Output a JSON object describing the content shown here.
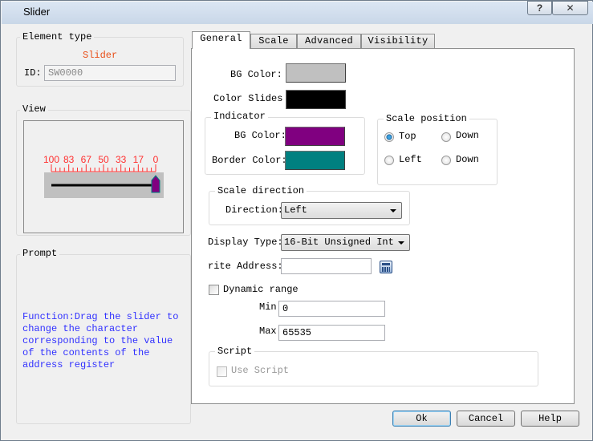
{
  "window": {
    "title": "Slider",
    "help_label": "?",
    "close_label": "✕"
  },
  "element_type": {
    "label": "Element type",
    "type": "Slider",
    "id_label": "ID:",
    "id_value": "SW0000"
  },
  "view": {
    "label": "View",
    "scale_labels": [
      "100",
      "83",
      "67",
      "50",
      "33",
      "17",
      "0"
    ],
    "slider_value": 0,
    "colors": {
      "scale": "#ff3030",
      "bg": "#c0c0c0",
      "track": "#000000",
      "indicator": "#800080",
      "indicator_border": "#008080"
    }
  },
  "prompt": {
    "label": "Prompt",
    "text": "Function:Drag the slider to change the character corresponding to the value of the contents of the address register"
  },
  "tabs": [
    {
      "label": "General",
      "selected": true
    },
    {
      "label": "Scale"
    },
    {
      "label": "Advanced"
    },
    {
      "label": "Visibility"
    }
  ],
  "general": {
    "bg_color_label": "BG Color:",
    "bg_color": "#c0c0c0",
    "color_slides_label": "Color Slides",
    "color_slides": "#000000",
    "indicator": {
      "label": "Indicator",
      "bg_color_label": "BG Color:",
      "bg_color": "#800080",
      "border_color_label": "Border Color:",
      "border_color": "#008080"
    },
    "scale_position": {
      "label": "Scale position",
      "options": [
        {
          "label": "Top",
          "checked": true
        },
        {
          "label": "Down",
          "checked": false
        },
        {
          "label": "Left",
          "checked": false
        },
        {
          "label": "Down",
          "checked": false
        }
      ]
    },
    "scale_direction": {
      "label": "Scale direction",
      "direction_label": "Direction:",
      "direction_value": "Left"
    },
    "display_type_label": "Display Type:",
    "display_type_value": "16-Bit Unsigned Int",
    "write_address_label": "rite Address:",
    "write_address_value": "",
    "dynamic_range_label": "Dynamic range",
    "dynamic_range_checked": false,
    "min_label": "Min:",
    "min_value": "0",
    "max_label": "Max:",
    "max_value": "65535",
    "script": {
      "label": "Script",
      "use_script_label": "Use Script",
      "use_script_checked": false
    }
  },
  "buttons": {
    "ok": "Ok",
    "cancel": "Cancel",
    "help": "Help"
  }
}
